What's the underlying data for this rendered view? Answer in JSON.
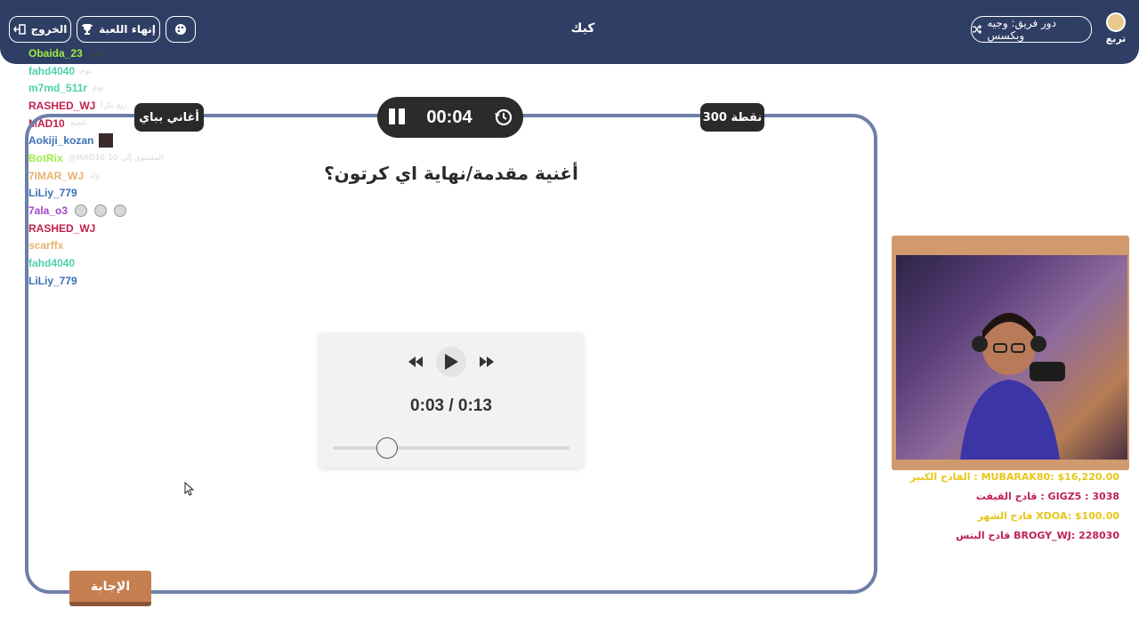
{
  "topbar": {
    "title": "كيك",
    "team_turn": "دور فريق: وجيه وبكسس",
    "logo_text": "تربع",
    "end_game": "إنهاء اللعبة",
    "exit": "الخروج",
    "colors": {
      "bar": "#2f3e64",
      "text": "#ffffff"
    },
    "icons": {
      "shuffle": "shuffle-icon",
      "trophy": "trophy-icon",
      "exit": "exit-icon",
      "palette": "palette-icon"
    }
  },
  "chat": [
    {
      "user": "Obaida_23",
      "color": "#9bee44",
      "msg": "سمير",
      "dark": true
    },
    {
      "user": "fahd4040",
      "color": "#4fcfb0",
      "msg": "يوم"
    },
    {
      "user": "m7md_511r",
      "color": "#4fcfb0",
      "msg": "يوم"
    },
    {
      "user": "RASHED_WJ",
      "color": "#c0224f",
      "msg": "ربع بكرا"
    },
    {
      "user": "MAD10",
      "color": "#c0224f",
      "msg": "الجنة"
    },
    {
      "user": "Aokiji_kozan",
      "color": "#3c6fb7",
      "msg": "",
      "avatar": true
    },
    {
      "user": "BotRix",
      "color": "#9bee44",
      "msg": "@MAD10 10 المستوى إلى"
    },
    {
      "user": "7IMAR_WJ",
      "color": "#e7b270",
      "msg": "ولد"
    },
    {
      "user": "LiLiy_779",
      "color": "#3c6fb7",
      "msg": ""
    },
    {
      "user": "7ala_o3",
      "color": "#a344c8",
      "msg": "",
      "emotes": 3
    },
    {
      "user": "RASHED_WJ",
      "color": "#c0224f",
      "msg": ""
    },
    {
      "user": "scarffx",
      "color": "#e7b270",
      "msg": ""
    },
    {
      "user": "fahd4040",
      "color": "#4fcfb0",
      "msg": ""
    },
    {
      "user": "LiLiy_779",
      "color": "#3c6fb7",
      "msg": ""
    }
  ],
  "game": {
    "category": "أغاني بباي",
    "points": "300 نقطة",
    "timer": "00:04",
    "question": "أغنية مقدمة/نهاية اي كرتون؟",
    "answer_button": "الإجابة",
    "frame_color": "#6d7fa8",
    "answer_color": "#c67f51"
  },
  "player": {
    "time": "0:03 / 0:13",
    "progress": 0.23,
    "icons": {
      "rewind": "rewind-icon",
      "play": "play-icon",
      "forward": "fast-forward-icon"
    }
  },
  "leaderboard": [
    {
      "text": "القادح الكبير : MUBARAK80: $16,220.00",
      "color": "#e6c619"
    },
    {
      "text": "قادح القيفت : GIGZ5 : 3038",
      "color": "#c0224f"
    },
    {
      "text": "قادح الشهر XDOA: $100.00",
      "color": "#e6c619"
    },
    {
      "text": "قادح البتس BROGY_WJ: 228030",
      "color": "#c0224f"
    }
  ]
}
